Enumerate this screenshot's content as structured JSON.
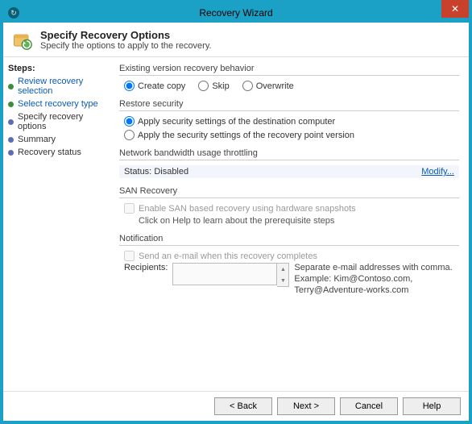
{
  "titlebar": {
    "title": "Recovery Wizard",
    "appicon_glyph": "↻"
  },
  "header": {
    "title": "Specify Recovery Options",
    "subtitle": "Specify the options to apply to the recovery."
  },
  "sidebar": {
    "title": "Steps:",
    "items": [
      {
        "label": "Review recovery selection",
        "kind": "link"
      },
      {
        "label": "Select recovery type",
        "kind": "link"
      },
      {
        "label": "Specify recovery options",
        "kind": "current"
      },
      {
        "label": "Summary",
        "kind": "plain"
      },
      {
        "label": "Recovery status",
        "kind": "plain"
      }
    ]
  },
  "main": {
    "version_behavior": {
      "title": "Existing version recovery behavior",
      "options": {
        "create_copy": "Create copy",
        "skip": "Skip",
        "overwrite": "Overwrite"
      },
      "selected": "create_copy"
    },
    "restore_security": {
      "title": "Restore security",
      "options": {
        "dest": "Apply security settings of the destination computer",
        "rpv": "Apply the security settings of the recovery point version"
      },
      "selected": "dest"
    },
    "throttling": {
      "title": "Network bandwidth usage throttling",
      "status_label": "Status:",
      "status_value": "Disabled",
      "modify": "Modify..."
    },
    "san": {
      "title": "SAN Recovery",
      "checkbox": "Enable SAN based recovery using hardware snapshots",
      "hint": "Click on Help to learn about the prerequisite steps"
    },
    "notification": {
      "title": "Notification",
      "checkbox": "Send an e-mail when this recovery completes",
      "recipients_label": "Recipients:",
      "hint1": "Separate e-mail addresses with comma.",
      "hint2": "Example: Kim@Contoso.com, Terry@Adventure-works.com"
    }
  },
  "footer": {
    "back": "< Back",
    "next": "Next >",
    "cancel": "Cancel",
    "help": "Help"
  }
}
